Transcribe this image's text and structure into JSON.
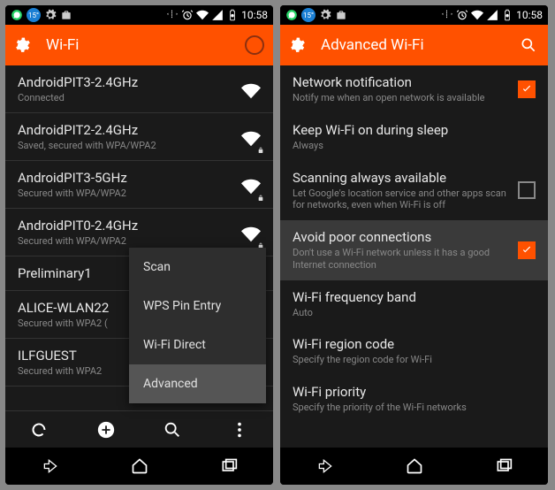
{
  "status": {
    "temp": "15°",
    "time": "10:58"
  },
  "left_screen": {
    "app_bar": {
      "title": "Wi-Fi"
    },
    "networks": [
      {
        "name": "AndroidPIT3-2.4GHz",
        "sub": "Connected",
        "locked": false
      },
      {
        "name": "AndroidPIT2-2.4GHz",
        "sub": "Saved, secured with WPA/WPA2",
        "locked": true
      },
      {
        "name": "AndroidPIT3-5GHz",
        "sub": "Secured with WPA/WPA2",
        "locked": true
      },
      {
        "name": "AndroidPIT0-2.4GHz",
        "sub": "Secured with WPA/WPA2",
        "locked": true
      },
      {
        "name": "Preliminary1",
        "sub": "",
        "locked": false
      },
      {
        "name": "ALICE-WLAN22",
        "sub": "Secured with WPA2 (",
        "locked": true
      },
      {
        "name": "ILFGUEST",
        "sub": "Secured with WPA2",
        "locked": true
      }
    ],
    "menu": {
      "items": [
        "Scan",
        "WPS Pin Entry",
        "Wi-Fi Direct",
        "Advanced"
      ],
      "highlighted": 3
    }
  },
  "right_screen": {
    "app_bar": {
      "title": "Advanced Wi-Fi"
    },
    "settings": [
      {
        "title": "Network notification",
        "sub": "Notify me when an open network is available",
        "type": "checkbox",
        "checked": true
      },
      {
        "title": "Keep Wi-Fi on during sleep",
        "sub": "Always",
        "type": "select"
      },
      {
        "title": "Scanning always available",
        "sub": "Let Google's location service and other apps scan for networks, even when Wi-Fi is off",
        "type": "checkbox",
        "checked": false
      },
      {
        "title": "Avoid poor connections",
        "sub": "Don't use a Wi-Fi network unless it has a good Internet connection",
        "type": "checkbox",
        "checked": true,
        "highlighted": true
      },
      {
        "title": "Wi-Fi frequency band",
        "sub": "Auto",
        "type": "select"
      },
      {
        "title": "Wi-Fi region code",
        "sub": "Specify the region code for Wi-Fi",
        "type": "select"
      },
      {
        "title": "Wi-Fi priority",
        "sub": "Specify the priority of the Wi-Fi networks",
        "type": "select"
      }
    ]
  }
}
